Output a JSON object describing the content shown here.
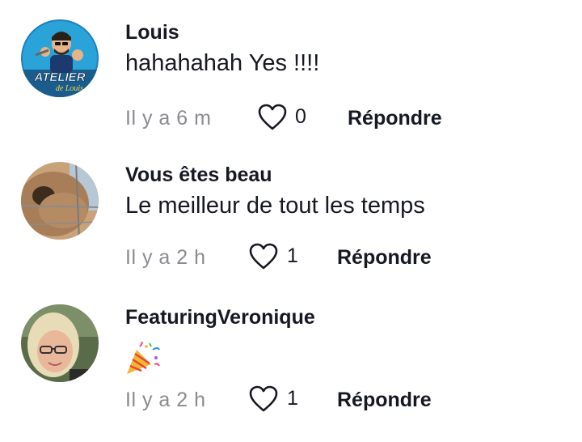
{
  "comments": [
    {
      "username": "Louis",
      "text": "hahahahah Yes !!!!",
      "time": "Il y a 6 m",
      "likes": "0",
      "reply_label": "Répondre",
      "avatar_text_1": "ATELIER",
      "avatar_text_2": "de Louis"
    },
    {
      "username": "Vous êtes beau",
      "text": "Le meilleur de tout les temps",
      "time": "Il y a 2 h",
      "likes": "1",
      "reply_label": "Répondre"
    },
    {
      "username": "FeaturingVeronique",
      "text": "",
      "emoji": "party-popper",
      "time": "Il y a 2 h",
      "likes": "1",
      "reply_label": "Répondre"
    }
  ],
  "icons": {
    "like": "heart-outline-icon",
    "emoji": "party-popper-icon"
  },
  "colors": {
    "primary_text": "#161823",
    "secondary_text": "#8a8b91",
    "avatar1_bg": "#2aa4d8"
  }
}
